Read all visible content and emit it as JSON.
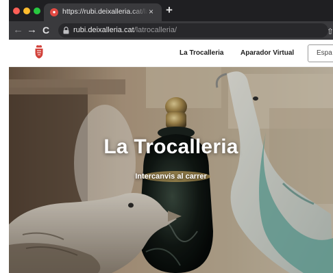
{
  "browser": {
    "tab": {
      "favicon": "deixalleria-favicon",
      "title": "https://rubi.deixalleria.cat/latrocalleria",
      "close_glyph": "×"
    },
    "new_tab_glyph": "+",
    "toolbar": {
      "back_glyph": "←",
      "forward_glyph": "→",
      "reload_glyph": "C",
      "url_host": "rubi.deixalleria.cat",
      "url_path": "/latrocalleria/",
      "share_glyph": "⇧",
      "bookmark_glyph": "☆"
    },
    "colors": {
      "tabstrip": "#1f1f22",
      "toolbar": "#3a3a3d",
      "address_bar": "#28282b"
    }
  },
  "site": {
    "logo": "coat-of-arms-icon",
    "nav": {
      "trocalleria": "La Trocalleria",
      "aparador": "Aparador Virtual",
      "language": "Espa"
    },
    "hero": {
      "title": "La Trocalleria",
      "subtitle": "Intercanvis al carrer"
    },
    "colors": {
      "hero_text": "#ffffff",
      "logo_red": "#d2413a"
    }
  }
}
